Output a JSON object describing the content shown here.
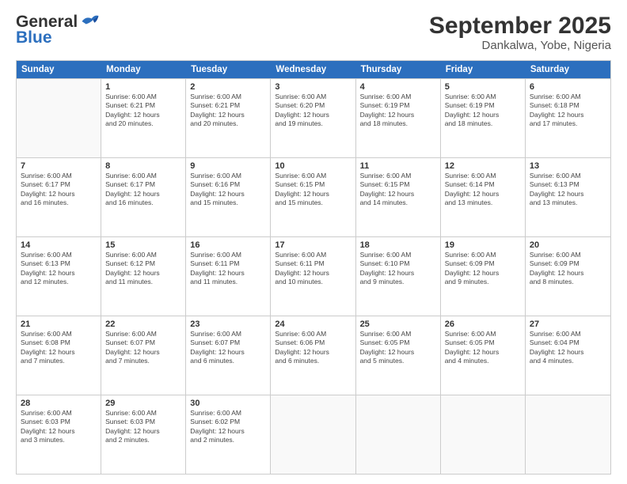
{
  "header": {
    "logo_general": "General",
    "logo_blue": "Blue",
    "title": "September 2025",
    "subtitle": "Dankalwa, Yobe, Nigeria"
  },
  "calendar": {
    "days": [
      "Sunday",
      "Monday",
      "Tuesday",
      "Wednesday",
      "Thursday",
      "Friday",
      "Saturday"
    ],
    "rows": [
      [
        {
          "day": "",
          "info": ""
        },
        {
          "day": "1",
          "info": "Sunrise: 6:00 AM\nSunset: 6:21 PM\nDaylight: 12 hours\nand 20 minutes."
        },
        {
          "day": "2",
          "info": "Sunrise: 6:00 AM\nSunset: 6:21 PM\nDaylight: 12 hours\nand 20 minutes."
        },
        {
          "day": "3",
          "info": "Sunrise: 6:00 AM\nSunset: 6:20 PM\nDaylight: 12 hours\nand 19 minutes."
        },
        {
          "day": "4",
          "info": "Sunrise: 6:00 AM\nSunset: 6:19 PM\nDaylight: 12 hours\nand 18 minutes."
        },
        {
          "day": "5",
          "info": "Sunrise: 6:00 AM\nSunset: 6:19 PM\nDaylight: 12 hours\nand 18 minutes."
        },
        {
          "day": "6",
          "info": "Sunrise: 6:00 AM\nSunset: 6:18 PM\nDaylight: 12 hours\nand 17 minutes."
        }
      ],
      [
        {
          "day": "7",
          "info": "Sunrise: 6:00 AM\nSunset: 6:17 PM\nDaylight: 12 hours\nand 16 minutes."
        },
        {
          "day": "8",
          "info": "Sunrise: 6:00 AM\nSunset: 6:17 PM\nDaylight: 12 hours\nand 16 minutes."
        },
        {
          "day": "9",
          "info": "Sunrise: 6:00 AM\nSunset: 6:16 PM\nDaylight: 12 hours\nand 15 minutes."
        },
        {
          "day": "10",
          "info": "Sunrise: 6:00 AM\nSunset: 6:15 PM\nDaylight: 12 hours\nand 15 minutes."
        },
        {
          "day": "11",
          "info": "Sunrise: 6:00 AM\nSunset: 6:15 PM\nDaylight: 12 hours\nand 14 minutes."
        },
        {
          "day": "12",
          "info": "Sunrise: 6:00 AM\nSunset: 6:14 PM\nDaylight: 12 hours\nand 13 minutes."
        },
        {
          "day": "13",
          "info": "Sunrise: 6:00 AM\nSunset: 6:13 PM\nDaylight: 12 hours\nand 13 minutes."
        }
      ],
      [
        {
          "day": "14",
          "info": "Sunrise: 6:00 AM\nSunset: 6:13 PM\nDaylight: 12 hours\nand 12 minutes."
        },
        {
          "day": "15",
          "info": "Sunrise: 6:00 AM\nSunset: 6:12 PM\nDaylight: 12 hours\nand 11 minutes."
        },
        {
          "day": "16",
          "info": "Sunrise: 6:00 AM\nSunset: 6:11 PM\nDaylight: 12 hours\nand 11 minutes."
        },
        {
          "day": "17",
          "info": "Sunrise: 6:00 AM\nSunset: 6:11 PM\nDaylight: 12 hours\nand 10 minutes."
        },
        {
          "day": "18",
          "info": "Sunrise: 6:00 AM\nSunset: 6:10 PM\nDaylight: 12 hours\nand 9 minutes."
        },
        {
          "day": "19",
          "info": "Sunrise: 6:00 AM\nSunset: 6:09 PM\nDaylight: 12 hours\nand 9 minutes."
        },
        {
          "day": "20",
          "info": "Sunrise: 6:00 AM\nSunset: 6:09 PM\nDaylight: 12 hours\nand 8 minutes."
        }
      ],
      [
        {
          "day": "21",
          "info": "Sunrise: 6:00 AM\nSunset: 6:08 PM\nDaylight: 12 hours\nand 7 minutes."
        },
        {
          "day": "22",
          "info": "Sunrise: 6:00 AM\nSunset: 6:07 PM\nDaylight: 12 hours\nand 7 minutes."
        },
        {
          "day": "23",
          "info": "Sunrise: 6:00 AM\nSunset: 6:07 PM\nDaylight: 12 hours\nand 6 minutes."
        },
        {
          "day": "24",
          "info": "Sunrise: 6:00 AM\nSunset: 6:06 PM\nDaylight: 12 hours\nand 6 minutes."
        },
        {
          "day": "25",
          "info": "Sunrise: 6:00 AM\nSunset: 6:05 PM\nDaylight: 12 hours\nand 5 minutes."
        },
        {
          "day": "26",
          "info": "Sunrise: 6:00 AM\nSunset: 6:05 PM\nDaylight: 12 hours\nand 4 minutes."
        },
        {
          "day": "27",
          "info": "Sunrise: 6:00 AM\nSunset: 6:04 PM\nDaylight: 12 hours\nand 4 minutes."
        }
      ],
      [
        {
          "day": "28",
          "info": "Sunrise: 6:00 AM\nSunset: 6:03 PM\nDaylight: 12 hours\nand 3 minutes."
        },
        {
          "day": "29",
          "info": "Sunrise: 6:00 AM\nSunset: 6:03 PM\nDaylight: 12 hours\nand 2 minutes."
        },
        {
          "day": "30",
          "info": "Sunrise: 6:00 AM\nSunset: 6:02 PM\nDaylight: 12 hours\nand 2 minutes."
        },
        {
          "day": "",
          "info": ""
        },
        {
          "day": "",
          "info": ""
        },
        {
          "day": "",
          "info": ""
        },
        {
          "day": "",
          "info": ""
        }
      ]
    ]
  }
}
